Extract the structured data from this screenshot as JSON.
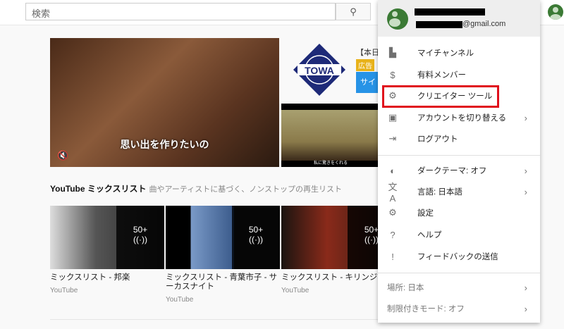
{
  "search": {
    "placeholder": "検索",
    "button_icon": "search-icon"
  },
  "hero": {
    "caption": "思い出を作りたいの",
    "mute_icon": "🔇"
  },
  "ad": {
    "logo_text": "TOWA",
    "title": "【本日",
    "badge": "広告",
    "button": "サイ",
    "small_video_caption": "私に驚きをくれる"
  },
  "section": {
    "title": "YouTube ミックスリスト",
    "subtitle": "曲やアーティストに基づく、ノンストップの再生リスト"
  },
  "mixes": [
    {
      "title": "ミックスリスト - 邦楽",
      "channel": "YouTube",
      "count": "50+"
    },
    {
      "title": "ミックスリスト - 青葉市子 - サーカスナイト",
      "channel": "YouTube",
      "count": "50+"
    },
    {
      "title": "ミックスリスト - キリンジ",
      "channel": "YouTube",
      "count": "50+"
    }
  ],
  "account": {
    "email_suffix": "@gmail.com"
  },
  "menu": {
    "items": [
      {
        "label": "マイチャンネル",
        "icon": "▙"
      },
      {
        "label": "有料メンバー",
        "icon": "$"
      },
      {
        "label": "クリエイター ツール",
        "icon": "⚙"
      },
      {
        "label": "アカウントを切り替える",
        "icon": "▣",
        "chev": "›"
      },
      {
        "label": "ログアウト",
        "icon": "⇥"
      },
      {
        "label": "ダークテーマ: オフ",
        "icon": "◐",
        "chev": "›"
      },
      {
        "label": "言語: 日本語",
        "icon": "文A",
        "chev": "›"
      },
      {
        "label": "設定",
        "icon": "⚙"
      },
      {
        "label": "ヘルプ",
        "icon": "?"
      },
      {
        "label": "フィードバックの送信",
        "icon": "!"
      },
      {
        "label": "場所: 日本",
        "chev": "›"
      },
      {
        "label": "制限付きモード: オフ",
        "chev": "›"
      }
    ]
  },
  "highlight_color": "#e0101c"
}
